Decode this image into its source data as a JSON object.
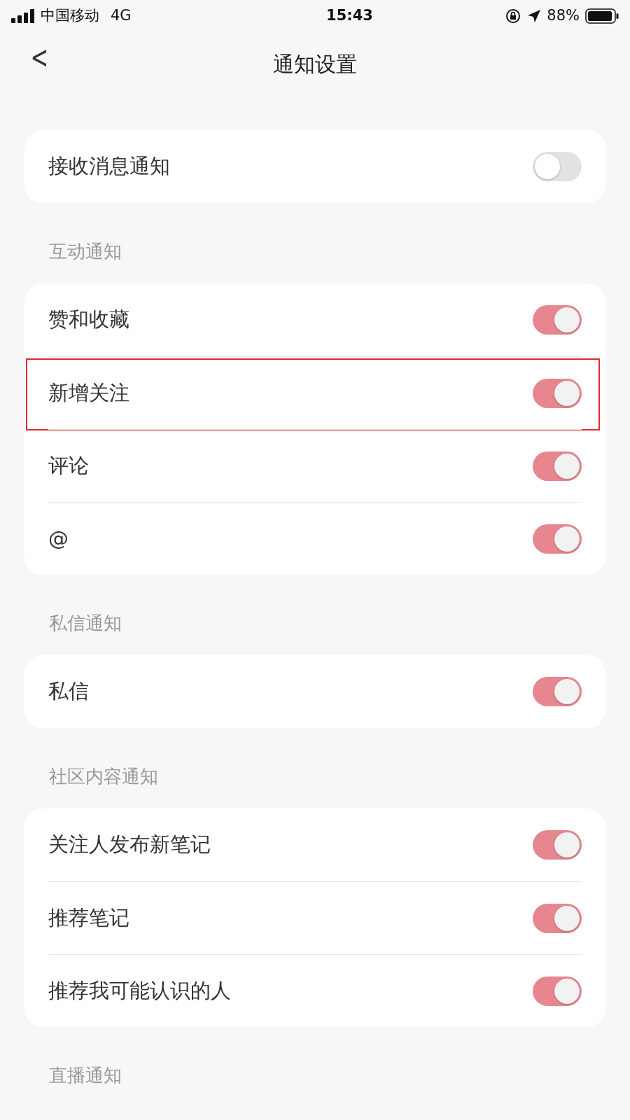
{
  "status_bar": {
    "carrier": "中国移动",
    "network": "4G",
    "time": "15:43",
    "battery": "88%"
  },
  "nav": {
    "back": "<",
    "title": "通知设置"
  },
  "sections": [
    {
      "rows": [
        {
          "label": "接收消息通知",
          "on": false,
          "highlighted": false
        }
      ]
    },
    {
      "header": "互动通知",
      "rows": [
        {
          "label": "赞和收藏",
          "on": true,
          "highlighted": false
        },
        {
          "label": "新增关注",
          "on": true,
          "highlighted": true
        },
        {
          "label": "评论",
          "on": true,
          "highlighted": false
        },
        {
          "label": "@",
          "on": true,
          "highlighted": false
        }
      ]
    },
    {
      "header": "私信通知",
      "rows": [
        {
          "label": "私信",
          "on": true,
          "highlighted": false
        }
      ]
    },
    {
      "header": "社区内容通知",
      "rows": [
        {
          "label": "关注人发布新笔记",
          "on": true,
          "highlighted": false
        },
        {
          "label": "推荐笔记",
          "on": true,
          "highlighted": false
        },
        {
          "label": "推荐我可能认识的人",
          "on": true,
          "highlighted": false
        }
      ]
    },
    {
      "header": "直播通知"
    }
  ]
}
